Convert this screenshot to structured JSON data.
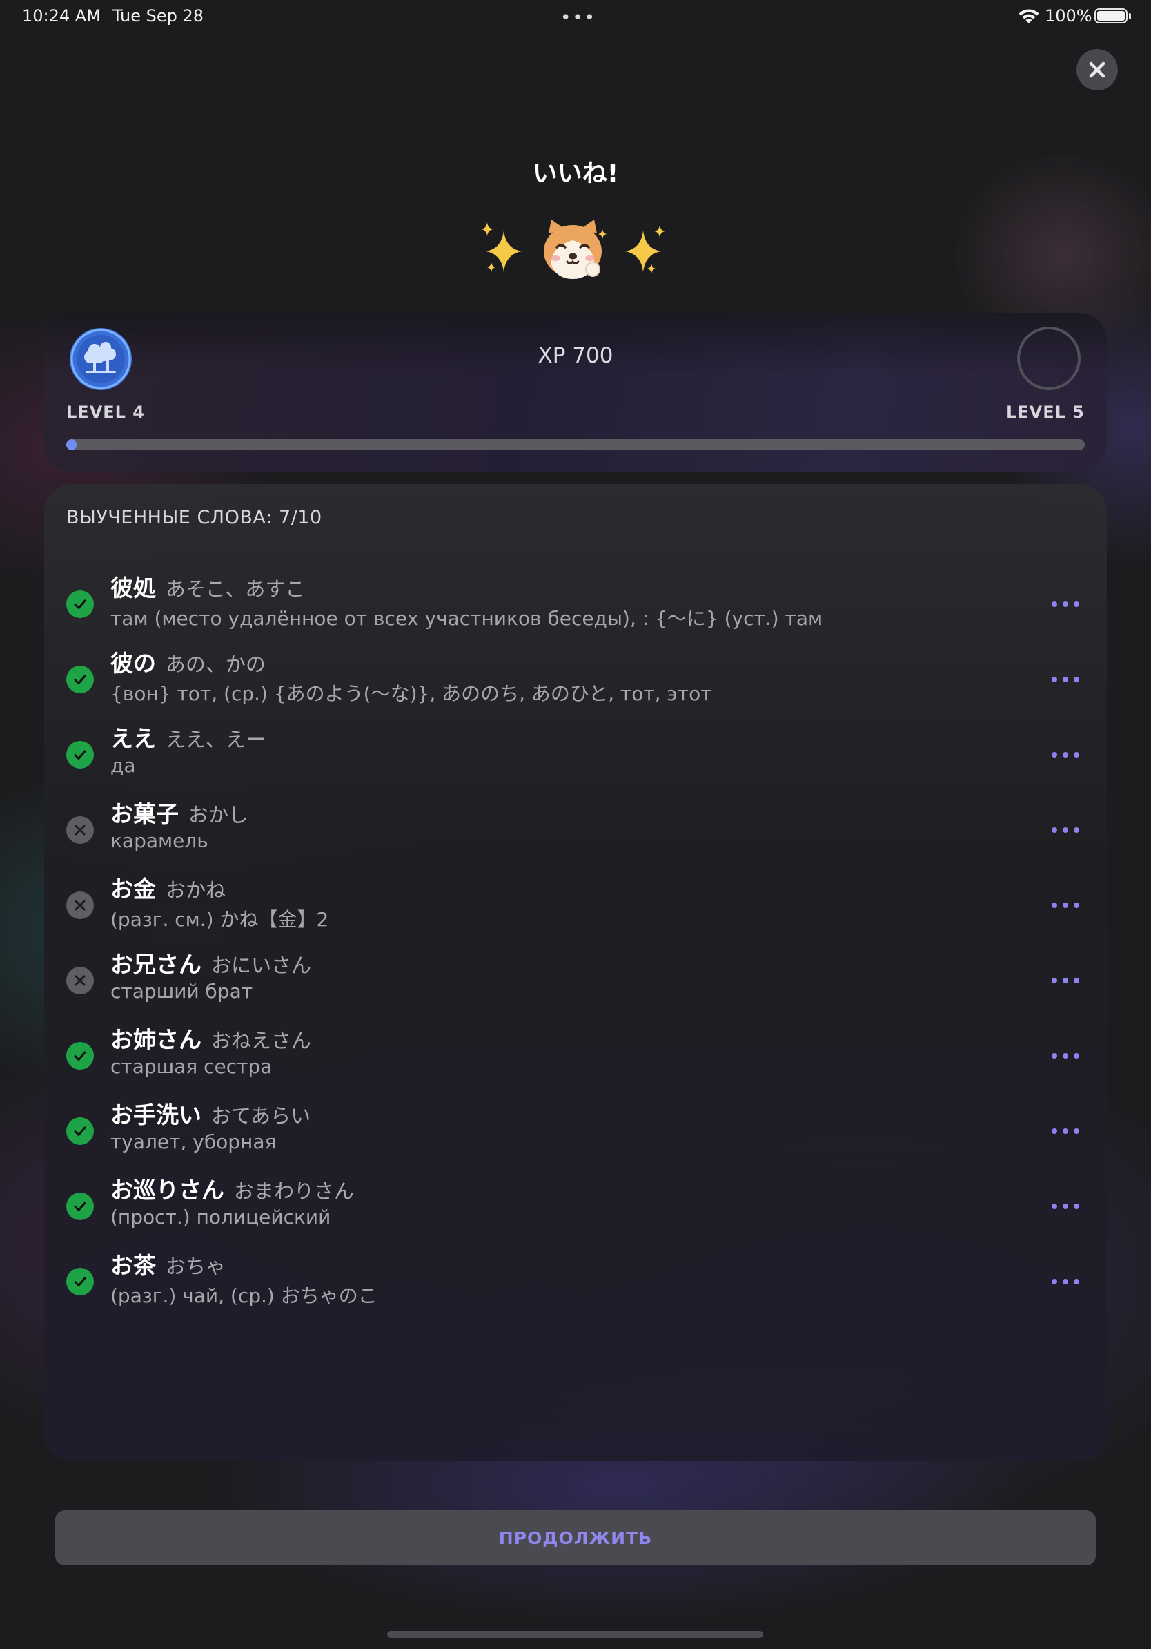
{
  "status_bar": {
    "time": "10:24 AM",
    "date": "Tue Sep 28",
    "multitasking_dots": "•••",
    "battery_percent": "100%",
    "battery_level": 1.0,
    "wifi_icon": "wifi-icon",
    "battery_icon": "battery-icon"
  },
  "header": {
    "title": "いいね!",
    "close_icon": "close-icon",
    "mascot": [
      "sparkles-icon",
      "shiba-dog-icon",
      "sparkles-icon"
    ]
  },
  "progress": {
    "xp_label": "XP 700",
    "current_level": "LEVEL 4",
    "next_level": "LEVEL 5",
    "progress_fraction": 0.01,
    "current_level_icon": "trees-icon",
    "accent_color": "#6f8ff0"
  },
  "words": {
    "header": "ВЫУЧЕННЫЕ СЛОВА: 7/10",
    "items": [
      {
        "status": "learned",
        "word": "彼処",
        "reading": "あそこ、あすこ",
        "meaning": "там (место удалённое от всех участников беседы), : {〜に} (уст.) там"
      },
      {
        "status": "learned",
        "word": "彼の",
        "reading": "あの、かの",
        "meaning": "{вон} тот, (ср.) {あのよう(〜な)}, あののち, あのひと, тот, этот"
      },
      {
        "status": "learned",
        "word": "ええ",
        "reading": "ええ、えー",
        "meaning": "да"
      },
      {
        "status": "not_learned",
        "word": "お菓子",
        "reading": "おかし",
        "meaning": "карамель"
      },
      {
        "status": "not_learned",
        "word": "お金",
        "reading": "おかね",
        "meaning": "(разг. см.) かね【金】2"
      },
      {
        "status": "not_learned",
        "word": "お兄さん",
        "reading": "おにいさん",
        "meaning": "старший брат"
      },
      {
        "status": "learned",
        "word": "お姉さん",
        "reading": "おねえさん",
        "meaning": "старшая сестра"
      },
      {
        "status": "learned",
        "word": "お手洗い",
        "reading": "おてあらい",
        "meaning": "туалет, уборная"
      },
      {
        "status": "learned",
        "word": "お巡りさん",
        "reading": "おまわりさん",
        "meaning": "(прост.) полицейский"
      },
      {
        "status": "learned",
        "word": "お茶",
        "reading": "おちゃ",
        "meaning": "(разг.) чай, (ср.) おちゃのこ"
      }
    ],
    "learned_icon": "checkmark-icon",
    "not_learned_icon": "x-mark-icon",
    "more_icon": "more-dots-icon",
    "learned_color": "#1ea446",
    "more_color": "#8c84f0"
  },
  "footer": {
    "continue_label": "ПРОДОЛЖИТЬ"
  }
}
